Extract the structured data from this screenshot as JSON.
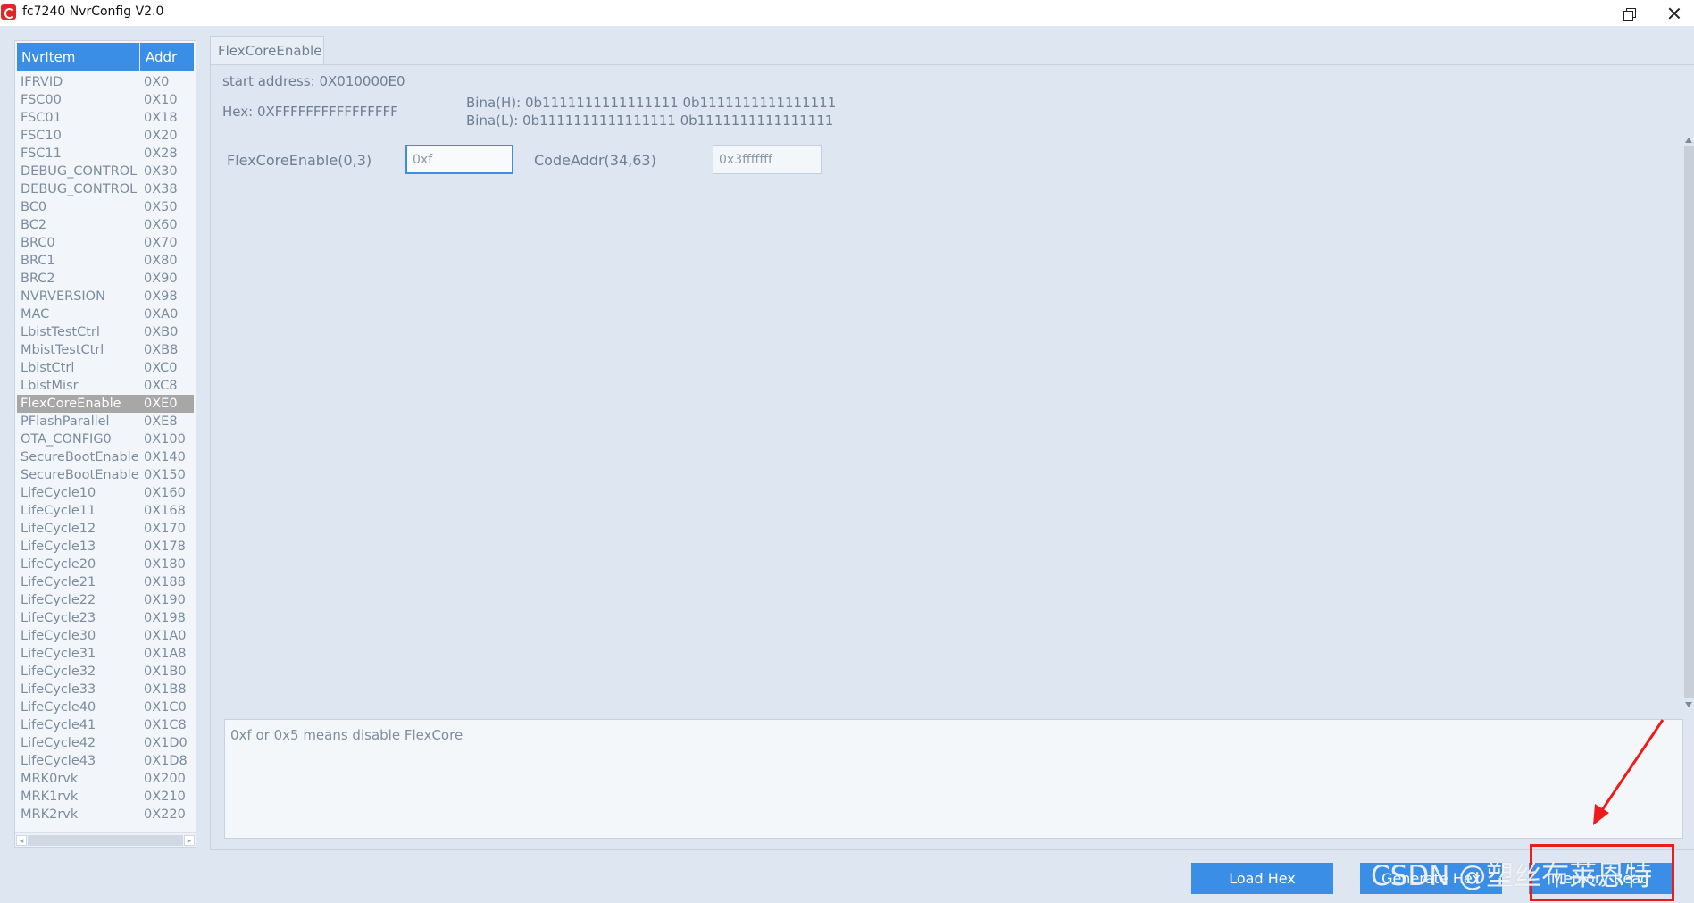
{
  "window": {
    "title": "fc7240 NvrConfig V2.0"
  },
  "nvr_list": {
    "headers": {
      "name": "NvrItem",
      "addr": "Addr"
    },
    "items": [
      {
        "name": "IFRVID",
        "addr": "0X0"
      },
      {
        "name": "FSC00",
        "addr": "0X10"
      },
      {
        "name": "FSC01",
        "addr": "0X18"
      },
      {
        "name": "FSC10",
        "addr": "0X20"
      },
      {
        "name": "FSC11",
        "addr": "0X28"
      },
      {
        "name": "DEBUG_CONTROL",
        "addr": "0X30"
      },
      {
        "name": "DEBUG_CONTROL",
        "addr": "0X38"
      },
      {
        "name": "BC0",
        "addr": "0X50"
      },
      {
        "name": "BC2",
        "addr": "0X60"
      },
      {
        "name": "BRC0",
        "addr": "0X70"
      },
      {
        "name": "BRC1",
        "addr": "0X80"
      },
      {
        "name": "BRC2",
        "addr": "0X90"
      },
      {
        "name": "NVRVERSION",
        "addr": "0X98"
      },
      {
        "name": "MAC",
        "addr": "0XA0"
      },
      {
        "name": "LbistTestCtrl",
        "addr": "0XB0"
      },
      {
        "name": "MbistTestCtrl",
        "addr": "0XB8"
      },
      {
        "name": "LbistCtrl",
        "addr": "0XC0"
      },
      {
        "name": "LbistMisr",
        "addr": "0XC8"
      },
      {
        "name": "FlexCoreEnable",
        "addr": "0XE0"
      },
      {
        "name": "PFlashParallel",
        "addr": "0XE8"
      },
      {
        "name": "OTA_CONFIG0",
        "addr": "0X100"
      },
      {
        "name": "SecureBootEnable",
        "addr": "0X140"
      },
      {
        "name": "SecureBootEnable",
        "addr": "0X150"
      },
      {
        "name": "LifeCycle10",
        "addr": "0X160"
      },
      {
        "name": "LifeCycle11",
        "addr": "0X168"
      },
      {
        "name": "LifeCycle12",
        "addr": "0X170"
      },
      {
        "name": "LifeCycle13",
        "addr": "0X178"
      },
      {
        "name": "LifeCycle20",
        "addr": "0X180"
      },
      {
        "name": "LifeCycle21",
        "addr": "0X188"
      },
      {
        "name": "LifeCycle22",
        "addr": "0X190"
      },
      {
        "name": "LifeCycle23",
        "addr": "0X198"
      },
      {
        "name": "LifeCycle30",
        "addr": "0X1A0"
      },
      {
        "name": "LifeCycle31",
        "addr": "0X1A8"
      },
      {
        "name": "LifeCycle32",
        "addr": "0X1B0"
      },
      {
        "name": "LifeCycle33",
        "addr": "0X1B8"
      },
      {
        "name": "LifeCycle40",
        "addr": "0X1C0"
      },
      {
        "name": "LifeCycle41",
        "addr": "0X1C8"
      },
      {
        "name": "LifeCycle42",
        "addr": "0X1D0"
      },
      {
        "name": "LifeCycle43",
        "addr": "0X1D8"
      },
      {
        "name": "MRK0rvk",
        "addr": "0X200"
      },
      {
        "name": "MRK1rvk",
        "addr": "0X210"
      },
      {
        "name": "MRK2rvk",
        "addr": "0X220"
      }
    ],
    "selected_index": 18
  },
  "detail": {
    "tab_label": "FlexCoreEnable",
    "start_address": "start address: 0X010000E0",
    "hex": "Hex: 0XFFFFFFFFFFFFFFFF",
    "bina_h": "Bina(H): 0b1111111111111111 0b1111111111111111",
    "bina_l": "Bina(L): 0b1111111111111111 0b1111111111111111",
    "fields": [
      {
        "label": "FlexCoreEnable(0,3)",
        "value": "0xf"
      },
      {
        "label": "CodeAddr(34,63)",
        "value": "0x3fffffff"
      }
    ],
    "description": "0xf or 0x5 means disable FlexCore"
  },
  "buttons": {
    "load_hex": "Load Hex",
    "generate_hex": "Generate Hex",
    "memory_read": "Memory Read"
  },
  "overlay": {
    "watermark": "CSDN @塑丝布莱恩特",
    "highlight_color": "#ee1b1b"
  },
  "colors": {
    "accent": "#3a8ee6",
    "selected_row": "#a7a7a7",
    "background": "#dde6f1"
  }
}
